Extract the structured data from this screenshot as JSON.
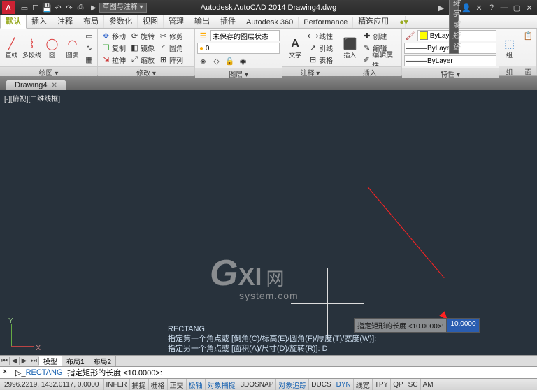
{
  "titlebar": {
    "app_icon": "A",
    "ws_label": "▶",
    "ws_combo": "草图与注释 ▾",
    "title_center": "Autodesk AutoCAD 2014   Drawing4.dwg",
    "search_placeholder": "键入关键字或短语"
  },
  "tabs": [
    "默认",
    "插入",
    "注释",
    "布局",
    "参数化",
    "视图",
    "管理",
    "输出",
    "插件",
    "Autodesk 360",
    "Performance",
    "精选应用"
  ],
  "ribbon": {
    "draw": {
      "title": "绘图 ▾",
      "line": "直线",
      "pline": "多段线",
      "circle": "圆",
      "arc": "圆弧"
    },
    "modify": {
      "title": "修改 ▾",
      "move": "移动",
      "copy": "复制",
      "stretch": "拉伸",
      "rotate": "旋转",
      "mirror": "镜像",
      "scale": "缩放",
      "trim": "修剪",
      "fillet": "圆角",
      "array": "阵列"
    },
    "layer": {
      "title": "图层 ▾",
      "unsaved": "未保存的图层状态",
      "bylayer0": "0"
    },
    "annot": {
      "title": "注释 ▾",
      "text": "文字"
    },
    "insert": {
      "title": "插入",
      "btn": "插入",
      "linetype": "线性",
      "leader": "引线",
      "table": "表格"
    },
    "props": {
      "title": "特性 ▾",
      "create": "创建",
      "edit": "编辑",
      "editattr": "编辑属性",
      "bylayer": "ByLayer"
    },
    "group": {
      "title": "组",
      "btn": "组"
    },
    "last": {
      "title": "面"
    }
  },
  "filetab": {
    "name": "Drawing4"
  },
  "viewport": {
    "label": "[-][俯视][二维线框]",
    "watermark_brand": "GXI",
    "watermark_net": "网",
    "watermark_sys": "system.com",
    "dyn_label": "指定矩形的长度 <10.0000>:",
    "dyn_value": "10.0000",
    "cmd_history": [
      "RECTANG",
      "指定第一个角点或 [倒角(C)/标高(E)/圆角(F)/厚度(T)/宽度(W)]:",
      "指定另一个角点或 [面积(A)/尺寸(D)/旋转(R)]: D"
    ]
  },
  "mtabs": {
    "model": "模型",
    "l1": "布局1",
    "l2": "布局2"
  },
  "cmdline": {
    "prefix": "×",
    "rect": "RECTANG",
    "text": "指定矩形的长度 <10.0000>:"
  },
  "status": {
    "coords": "2996.2219, 1432.0117, 0.0000",
    "btns": [
      "INFER",
      "捕捉",
      "栅格",
      "正交",
      "极轴",
      "对象捕捉",
      "3DOSNAP",
      "对象追踪",
      "DUCS",
      "DYN",
      "线宽",
      "TPY",
      "QP",
      "SC",
      "AM"
    ]
  }
}
